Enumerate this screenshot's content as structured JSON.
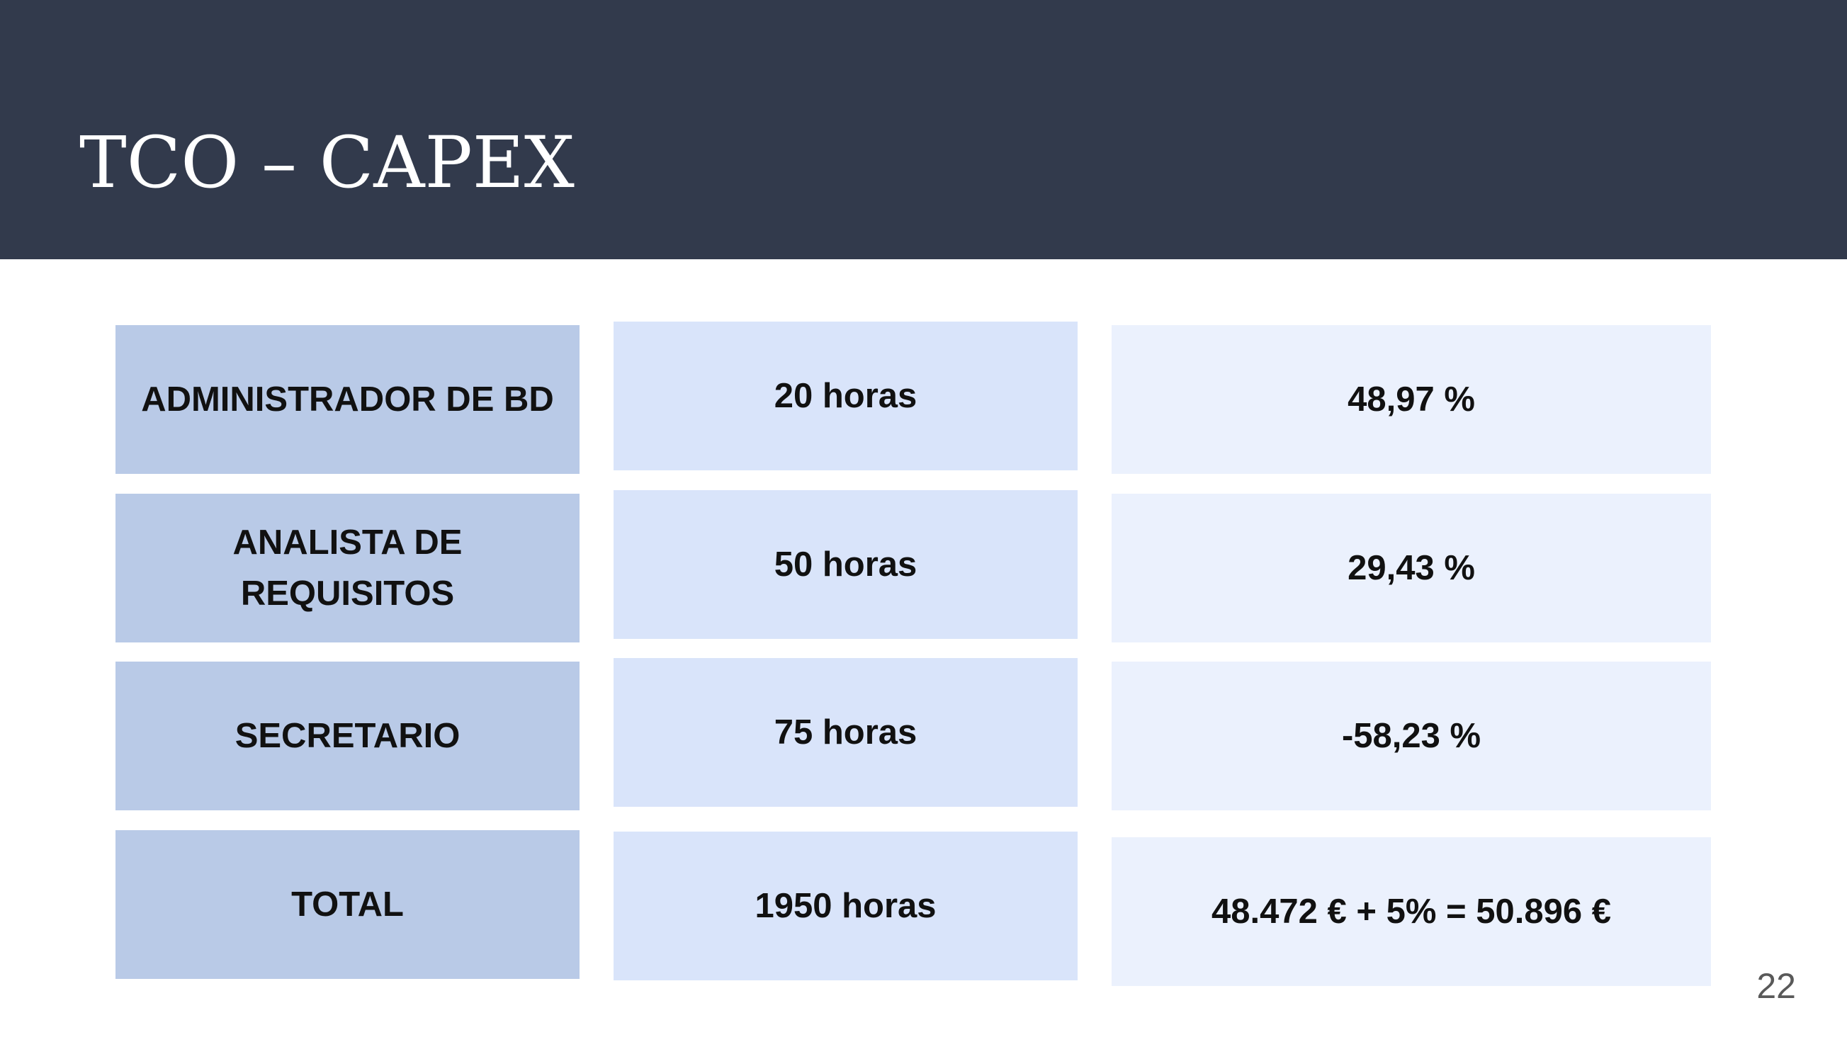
{
  "slide": {
    "title": "TCO – CAPEX",
    "page_number": "22"
  },
  "table": {
    "rows": [
      {
        "role": "ADMINISTRADOR DE BD",
        "hours": "20 horas",
        "value": "48,97 %"
      },
      {
        "role": "ANALISTA DE REQUISITOS",
        "hours": "50 horas",
        "value": "29,43 %"
      },
      {
        "role": "SECRETARIO",
        "hours": "75 horas",
        "value": "-58,23 %"
      },
      {
        "role": "TOTAL",
        "hours": "1950 horas",
        "value": "48.472 € + 5% = 50.896 €"
      }
    ]
  },
  "colors": {
    "header_background": "#323a4c",
    "title_text": "#ffffff",
    "role_cell": "#b9cae7",
    "hours_cell": "#d9e4fa",
    "value_cell": "#ebf1fd",
    "cell_text": "#111111",
    "page_number_text": "#595959"
  }
}
